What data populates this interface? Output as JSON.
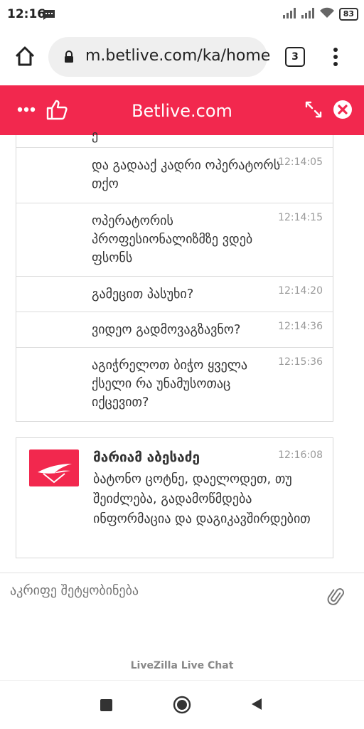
{
  "status_bar": {
    "time": "12:16",
    "battery": "83"
  },
  "browser": {
    "url": "m.betlive.com/ka/home",
    "tab_count": "3"
  },
  "header": {
    "title": "Betlive.com",
    "brand_color": "#f2284e"
  },
  "chat": {
    "cut_off_text": "ე",
    "messages": [
      {
        "text": "და გადააქ კადრი ოპერატორს თქო",
        "time": "12:14:05"
      },
      {
        "text": "ოპერატორის პროფესიონალიზმზე ვდებ ფსონს",
        "time": "12:14:15"
      },
      {
        "text": "გამეცით პასუხი?",
        "time": "12:14:20"
      },
      {
        "text": "ვიდეო გადმოვაგზავნო?",
        "time": "12:14:36"
      },
      {
        "text": "აგიჭრელოთ ბიჭო ყველა ქსელი რა უნამუსოთაც იქცევით?",
        "time": "12:15:36"
      }
    ],
    "agent": {
      "name": "მარიამ აბესაძე",
      "time": "12:16:08",
      "text": "ბატონო ცოტნე, დაელოდეთ, თუ შეიძლება, გადამოწმდება ინფორმაცია და დაგიკავშირდებით"
    }
  },
  "composer": {
    "placeholder": "აკრიფე შეტყობინება"
  },
  "footer": {
    "text": "LiveZilla Live Chat"
  }
}
